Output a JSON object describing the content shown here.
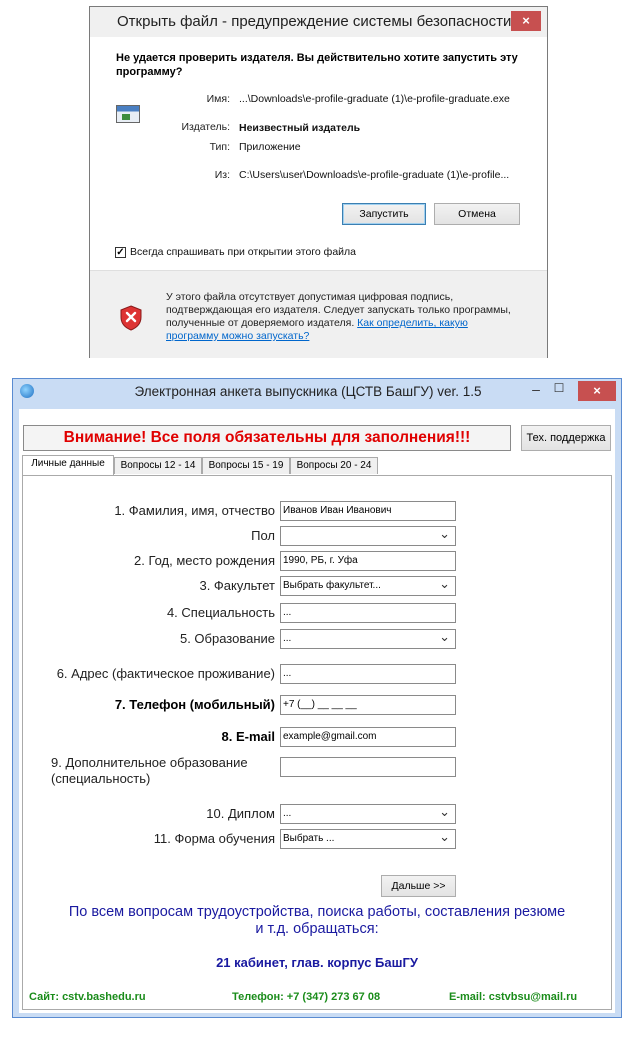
{
  "security_dialog": {
    "title": "Открыть файл - предупреждение системы безопасности",
    "close_glyph": "×",
    "question": "Не удается проверить издателя. Вы действительно хотите запустить эту программу?",
    "fields": [
      {
        "label": "Имя:",
        "value": "...\\Downloads\\e-profile-graduate (1)\\e-profile-graduate.exe",
        "bold": false
      },
      {
        "label": "Издатель:",
        "value": "Неизвестный издатель",
        "bold": true
      },
      {
        "label": "Тип:",
        "value": "Приложение",
        "bold": false
      },
      {
        "label": "Из:",
        "value": "C:\\Users\\user\\Downloads\\e-profile-graduate (1)\\e-profile...",
        "bold": false
      }
    ],
    "run_button": "Запустить",
    "cancel_button": "Отмена",
    "always_ask_label": "Всегда спрашивать при открытии этого файла",
    "always_ask_checked": true,
    "warning_text": "У этого файла отсутствует допустимая цифровая подпись, подтверждающая его издателя. Следует запускать только программы, полученные от доверяемого издателя.",
    "warning_link": "Как определить, какую программу можно запускать?",
    "icons": {
      "app": "exe-file-icon",
      "warning": "red-shield-icon"
    }
  },
  "app_window": {
    "title": "Электронная анкета выпускника (ЦСТВ БашГУ) ver. 1.5",
    "minimize_glyph": "–",
    "maximize_glyph": "☐",
    "close_glyph": "×",
    "warning_banner": "Внимание! Все поля обязательны для заполнения!!!",
    "support_button": "Тех. поддержка",
    "tabs": [
      {
        "label": "Личные данные",
        "active": true
      },
      {
        "label": "Вопросы 12 - 14",
        "active": false
      },
      {
        "label": "Вопросы 15 - 19",
        "active": false
      },
      {
        "label": "Вопросы 20 - 24",
        "active": false
      }
    ],
    "form": {
      "full_name": {
        "label": "1. Фамилия, имя, отчество",
        "value": "Иванов Иван Иванович"
      },
      "gender": {
        "label": "Пол",
        "value": ""
      },
      "birth": {
        "label": "2. Год, место рождения",
        "value": "1990, РБ, г. Уфа"
      },
      "faculty": {
        "label": "3. Факультет",
        "value": "Выбрать факультет..."
      },
      "specialty": {
        "label": "4. Специальность",
        "value": "..."
      },
      "education": {
        "label": "5. Образование",
        "value": "..."
      },
      "address": {
        "label": "6. Адрес (фактическое проживание)",
        "value": "..."
      },
      "phone": {
        "label": "7. Телефон (мобильный)",
        "value": "+7 (__) __ __ __"
      },
      "email": {
        "label": "8. E-mail",
        "value": "example@gmail.com"
      },
      "extra_edu": {
        "label_line1": "9. Дополнительное образование",
        "label_line2": "(специальность)",
        "value": ""
      },
      "diploma": {
        "label": "10. Диплом",
        "value": "..."
      },
      "study_form": {
        "label": "11. Форма обучения",
        "value": "Выбрать ..."
      }
    },
    "next_button": "Дальше >>",
    "info_line1": "По всем вопросам трудоустройства, поиска работы, составления резюме",
    "info_line2": "и т.д. обращаться:",
    "office": "21 кабинет, глав. корпус БашГУ",
    "footer": {
      "site": "Сайт: cstv.bashedu.ru",
      "phone": "Телефон: +7 (347) 273 67 08",
      "email": "E-mail: cstvbsu@mail.ru"
    },
    "colors": {
      "banner_red": "#e00000",
      "info_blue": "#1a1aa0",
      "footer_green": "#1a8c1a",
      "frame_blue": "#c9dcf4"
    }
  }
}
